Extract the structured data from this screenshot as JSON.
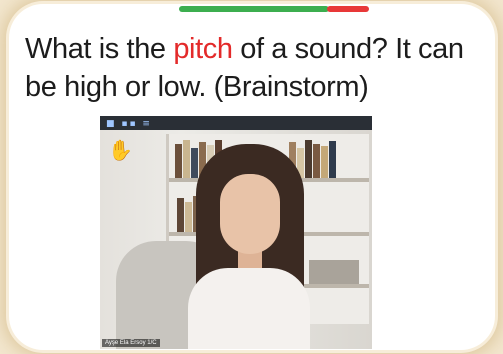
{
  "slide": {
    "question_part1": "What is the ",
    "question_highlight": "pitch",
    "question_part2": " of a sound? It can be high or low. (Brainstorm)",
    "highlight_color": "#e32a2a"
  },
  "video_tile": {
    "participant_name": "Ayşe Ela Ersoy 1/C",
    "raised_hand_icon": "raised-hand-icon",
    "toolbar_icons": [
      "view-options-icon"
    ]
  }
}
